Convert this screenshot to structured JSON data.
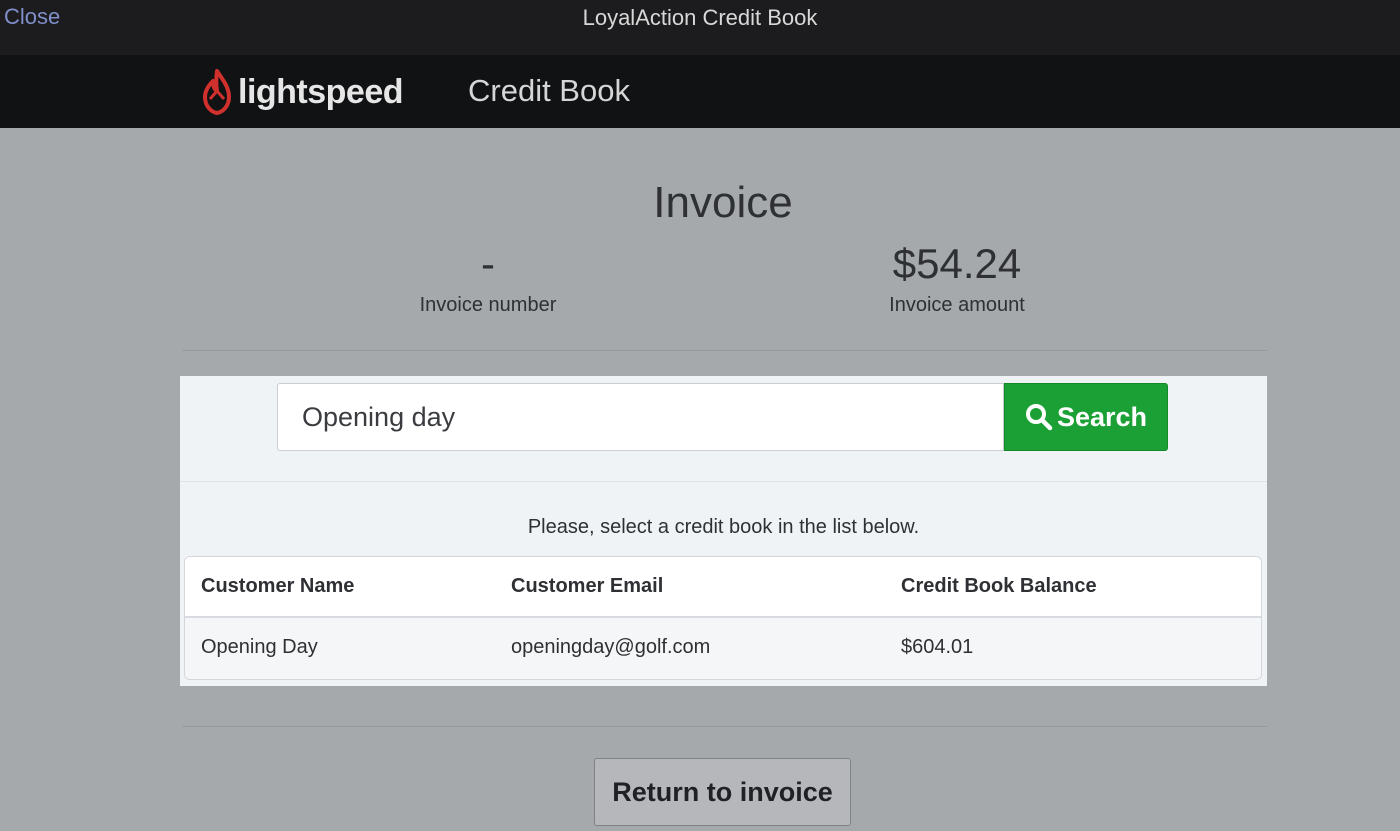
{
  "window": {
    "close_label": "Close",
    "title": "LoyalAction Credit Book"
  },
  "header": {
    "logo_text": "lightspeed",
    "app_name": "Credit Book",
    "brand_color": "#d0312d"
  },
  "invoice": {
    "heading": "Invoice",
    "number_value": "-",
    "number_label": "Invoice number",
    "amount_value": "$54.24",
    "amount_label": "Invoice amount"
  },
  "search": {
    "value": "Opening day",
    "button_label": "Search",
    "button_color": "#1aa034"
  },
  "instruction": "Please, select a credit book in the list below.",
  "table": {
    "columns": [
      "Customer Name",
      "Customer Email",
      "Credit Book Balance"
    ],
    "rows": [
      [
        "Opening Day",
        "openingday@golf.com",
        "$604.01"
      ]
    ]
  },
  "footer": {
    "return_label": "Return to invoice"
  }
}
